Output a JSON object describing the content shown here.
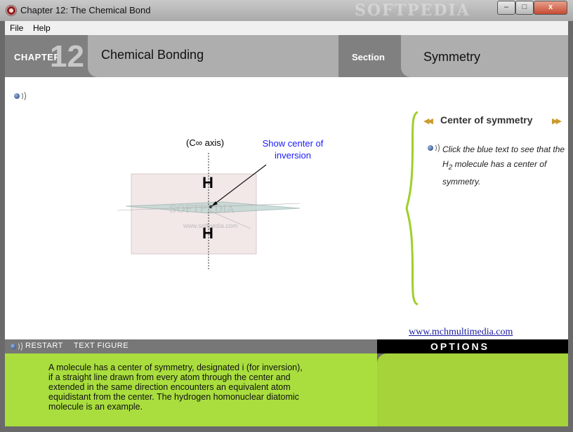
{
  "window": {
    "title": "Chapter 12: The Chemical Bond",
    "watermark": "SOFTPEDIA",
    "controls": {
      "minimize": "–",
      "maximize": "□",
      "close": "x"
    }
  },
  "menu": [
    "File",
    "Help"
  ],
  "header": {
    "chapter_label": "CHAPTER",
    "chapter_number": "12",
    "topic": "Chemical Bonding",
    "section_label": "Section",
    "section_name": "Symmetry"
  },
  "figure": {
    "axis_label": "(C∞ axis)",
    "link_text": "Show center of inversion",
    "atom_top": "H",
    "atom_bottom": "H",
    "watermark": "SOFTPEDIA",
    "watermark_url": "www.softpedia.com"
  },
  "side_panel": {
    "prev_arrow": "◀◀",
    "next_arrow": "▶▶",
    "title": "Center of symmetry",
    "instruction_pre": "Click the blue text to see that the H",
    "instruction_sub": "2",
    "instruction_post": " molecule has a center of symmetry."
  },
  "url": "www.mchmultimedia.com",
  "bottom_bar": {
    "restart": "RESTART",
    "text_figure": "TEXT FIGURE",
    "options": "OPTIONS"
  },
  "description": "A molecule has a center of symmetry, designated i (for inversion), if a straight line drawn from every atom through the center and extended in the same direction encounters an equivalent atom equidistant from the center. The hydrogen homonuclear diatomic molecule is an example.",
  "colors": {
    "accent_green": "#a9de3e",
    "brace_green": "#9fcf2a",
    "link_blue": "#1a1aff",
    "header_gray": "#808080",
    "tab_gray": "#aeaeae"
  }
}
